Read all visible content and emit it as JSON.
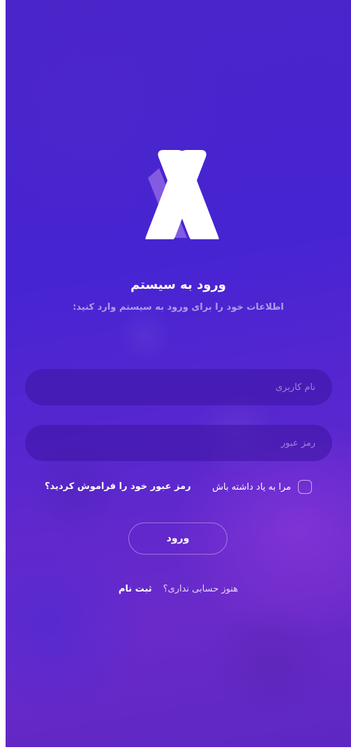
{
  "header": {
    "title": "ورود به سیستم",
    "subtitle": "اطلاعات خود را برای ورود به سیستم وارد کنید:"
  },
  "form": {
    "username_placeholder": "نام کاربری",
    "username_value": "",
    "password_placeholder": "رمز عبور",
    "password_value": "",
    "remember_label": "مرا به یاد داشته باش",
    "remember_checked": false,
    "forgot_label": "رمز عبور خود را فراموش کردید؟",
    "submit_label": "ورود"
  },
  "footer": {
    "no_account_text": "هنوز حسابی نداری؟",
    "signup_label": "ثبت نام"
  },
  "colors": {
    "background_start": "#4a25c9",
    "background_end": "#6a2ac9",
    "text": "#ffffff",
    "field_bg": "#3c14a0"
  },
  "logo": {
    "icon": "brand-logo-icon"
  }
}
